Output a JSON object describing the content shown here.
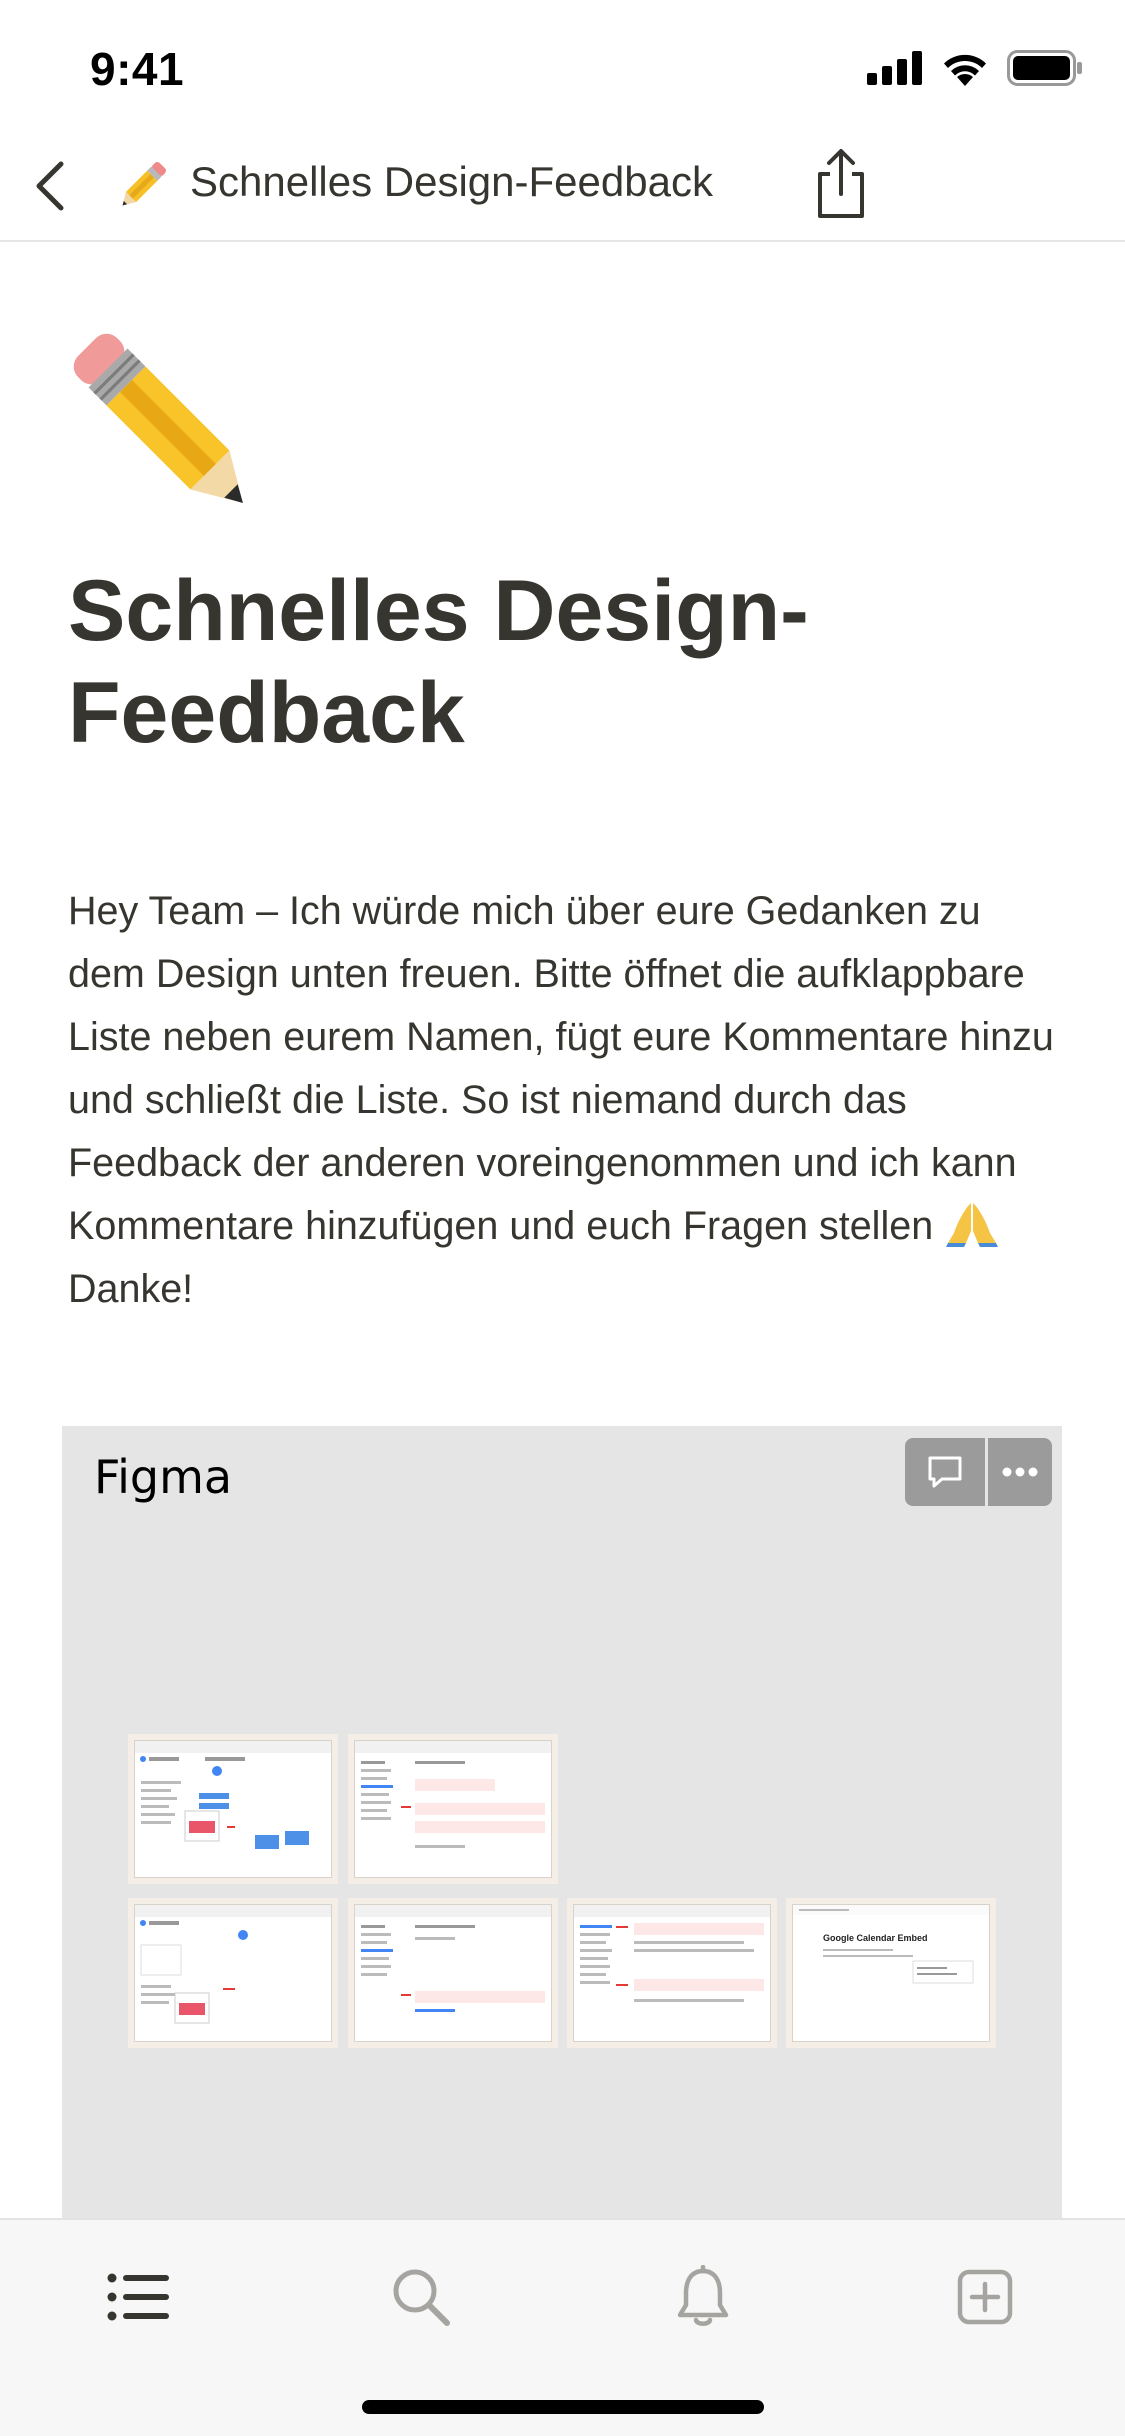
{
  "status_bar": {
    "time": "9:41",
    "icons": [
      "cellular-signal-icon",
      "wifi-icon",
      "battery-icon"
    ]
  },
  "nav": {
    "title": "Schnelles Design-Feedback",
    "icons": [
      "back-chevron-icon",
      "pencil-emoji-icon",
      "share-icon"
    ]
  },
  "page": {
    "icon": "pencil-emoji-icon",
    "title": "Schnelles Design-Feedback",
    "body_text": "Hey Team – Ich würde mich über eure Gedanken zu dem Design unten freuen. Bitte öffnet die aufklappbare Liste neben eurem Namen, fügt eure Kommentare hinzu und schließt die Liste. So ist niemand durch das Feedback der anderen voreingenommen und ich kann Kommentare hinzufügen und euch Fragen stellen",
    "body_emoji": "folded-hands-emoji-icon",
    "body_tail": " Danke!"
  },
  "embed": {
    "title": "Figma",
    "action_icons": [
      "comment-icon",
      "more-icon"
    ],
    "frames": [
      {
        "name": "calendar-week-frame"
      },
      {
        "name": "settings-frame-1"
      },
      {
        "name": "calendar-month-frame"
      },
      {
        "name": "settings-frame-2"
      },
      {
        "name": "settings-frame-3"
      },
      {
        "name": "google-calendar-embed-frame",
        "caption": "Google Calendar Embed"
      }
    ]
  },
  "tab_bar": {
    "tabs": [
      {
        "icon": "list-icon"
      },
      {
        "icon": "search-icon"
      },
      {
        "icon": "bell-icon"
      },
      {
        "icon": "new-page-icon"
      }
    ]
  },
  "colors": {
    "text": "#37352f",
    "embed_bg": "#e5e5e5",
    "embed_button": "#9b9b9b",
    "tab_bar_bg": "#f7f7f7"
  }
}
